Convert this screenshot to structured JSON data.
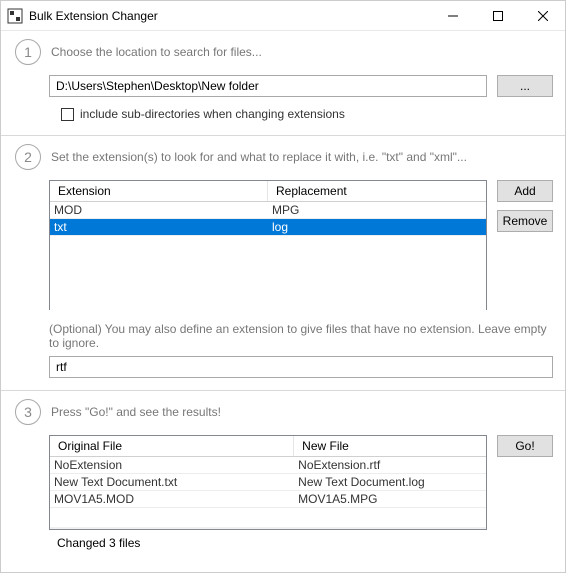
{
  "titlebar": {
    "title": "Bulk Extension Changer"
  },
  "step1": {
    "label": "1",
    "text": "Choose the location to search for files...",
    "path": "D:\\Users\\Stephen\\Desktop\\New folder",
    "browse": "...",
    "include_sub": "include sub-directories when changing extensions"
  },
  "step2": {
    "label": "2",
    "text": "Set the extension(s) to look for and what to replace it with, i.e. \"txt\" and \"xml\"...",
    "headers": {
      "ext": "Extension",
      "rep": "Replacement"
    },
    "rows": [
      {
        "ext": "MOD",
        "rep": "MPG",
        "selected": false
      },
      {
        "ext": "txt",
        "rep": "log",
        "selected": true
      }
    ],
    "add": "Add",
    "remove": "Remove",
    "note": "(Optional) You may also define an extension to give files that have no extension. Leave empty to ignore.",
    "noext_value": "rtf"
  },
  "step3": {
    "label": "3",
    "text": "Press \"Go!\" and see the results!",
    "headers": {
      "orig": "Original File",
      "new": "New File"
    },
    "rows": [
      {
        "orig": "NoExtension",
        "new": "NoExtension.rtf"
      },
      {
        "orig": "New Text Document.txt",
        "new": "New Text Document.log"
      },
      {
        "orig": "MOV1A5.MOD",
        "new": "MOV1A5.MPG"
      }
    ],
    "go": "Go!",
    "status": "Changed 3 files"
  }
}
